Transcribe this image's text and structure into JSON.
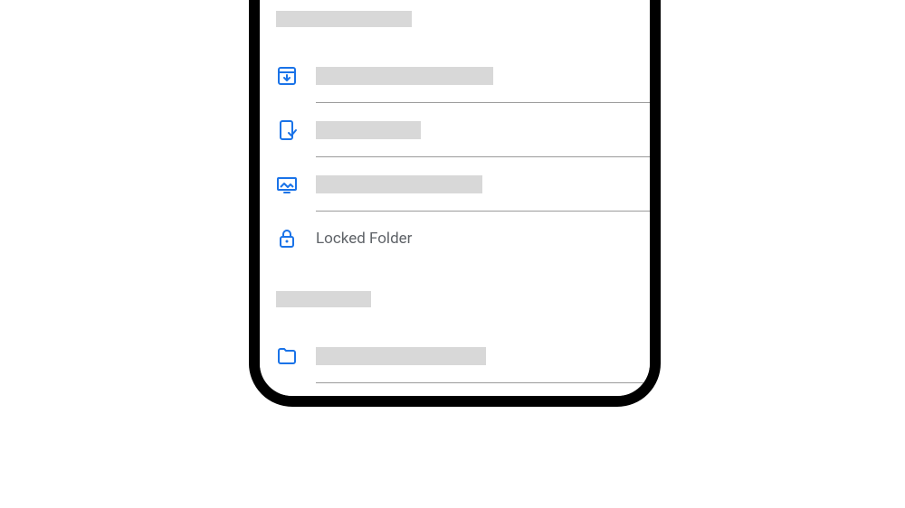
{
  "colors": {
    "icon_blue": "#1a73e8",
    "placeholder_gray": "#d8d8d8",
    "text_gray": "#5f6368",
    "divider_gray": "#9b9b9b"
  },
  "list": {
    "section1": {
      "header_placeholder": true,
      "items": [
        {
          "icon": "archive-icon",
          "placeholder": true
        },
        {
          "icon": "device-check-icon",
          "placeholder": true
        },
        {
          "icon": "photo-frame-icon",
          "placeholder": true
        },
        {
          "icon": "lock-icon",
          "label": "Locked Folder"
        }
      ]
    },
    "section2": {
      "header_placeholder": true,
      "items": [
        {
          "icon": "folder-icon",
          "placeholder": true
        }
      ]
    }
  }
}
